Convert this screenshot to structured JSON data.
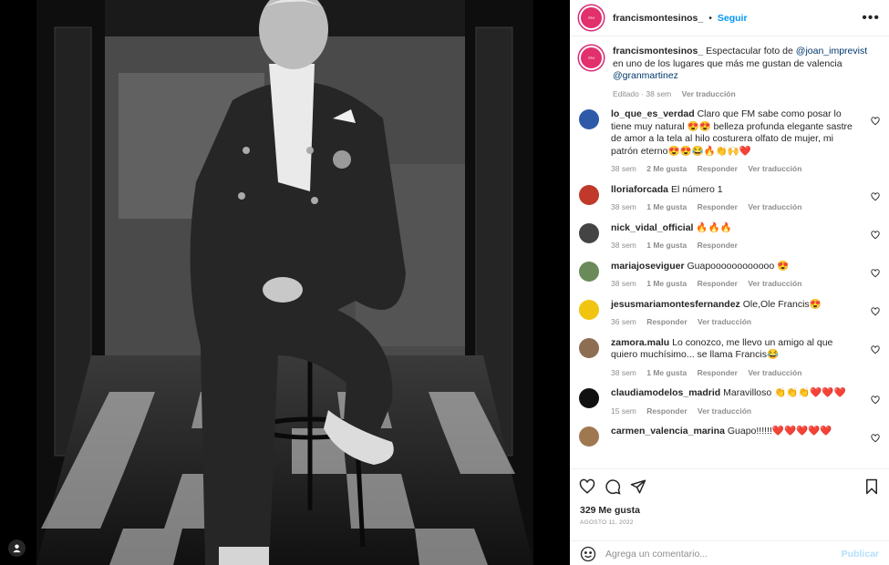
{
  "header": {
    "username": "francismontesinos_",
    "dot": "•",
    "follow_label": "Seguir",
    "more": "•••"
  },
  "caption": {
    "username": "francismontesinos_",
    "text_pre": "Espectacular foto de",
    "mention1": "@joan_imprevist",
    "text_post": "en uno de los lugares que más me gustan de valencia",
    "mention2": "@granmartinez",
    "edited": "Editado · 38 sem",
    "translate": "Ver traducción"
  },
  "comments": [
    {
      "username": "lo_que_es_verdad",
      "text": "Claro que FM sabe como posar lo tiene muy natural 😍😍 belleza profunda elegante sastre de amor a la tela al hilo costurera olfato de mujer, mi patrón eterno😍😍😂🔥👏🙌❤️",
      "time": "38 sem",
      "likes": "2 Me gusta",
      "reply": "Responder",
      "translate": "Ver traducción",
      "avatar_color": "#2e5aa8"
    },
    {
      "username": "lloriaforcada",
      "text": "El número 1",
      "time": "38 sem",
      "likes": "1 Me gusta",
      "reply": "Responder",
      "translate": "Ver traducción",
      "avatar_color": "#c0392b"
    },
    {
      "username": "nick_vidal_official",
      "text": "🔥🔥🔥",
      "time": "38 sem",
      "likes": "1 Me gusta",
      "reply": "Responder",
      "translate": "",
      "avatar_color": "#444444"
    },
    {
      "username": "mariajoseviguer",
      "text": "Guapoooooooooooo 😍",
      "time": "38 sem",
      "likes": "1 Me gusta",
      "reply": "Responder",
      "translate": "Ver traducción",
      "avatar_color": "#6a8a5a"
    },
    {
      "username": "jesusmariamontesfernandez",
      "text": "Ole,Ole Francis😍",
      "time": "36 sem",
      "likes": "",
      "reply": "Responder",
      "translate": "Ver traducción",
      "avatar_color": "#f1c40f"
    },
    {
      "username": "zamora.malu",
      "text": "Lo conozco, me llevo un amigo al que quiero muchísimo... se llama Francis😂",
      "time": "38 sem",
      "likes": "1 Me gusta",
      "reply": "Responder",
      "translate": "Ver traducción",
      "avatar_color": "#8e6e53"
    },
    {
      "username": "claudiamodelos_madrid",
      "text": "Maravilloso 👏👏👏❤️❤️❤️",
      "time": "15 sem",
      "likes": "",
      "reply": "Responder",
      "translate": "Ver traducción",
      "avatar_color": "#111111"
    },
    {
      "username": "carmen_valencia_marina",
      "text": "Guapo!!!!!!❤️❤️❤️❤️❤️",
      "time": "",
      "likes": "",
      "reply": "",
      "translate": "",
      "avatar_color": "#a07850"
    }
  ],
  "actions": {
    "likes": "329 Me gusta",
    "date": "AGOSTO 11, 2022",
    "comment_placeholder": "Agrega un comentario...",
    "post_label": "Publicar"
  },
  "colors": {
    "accent": "#0095f6",
    "avatar_ring": "#d62976",
    "muted": "#8e8e8e"
  }
}
